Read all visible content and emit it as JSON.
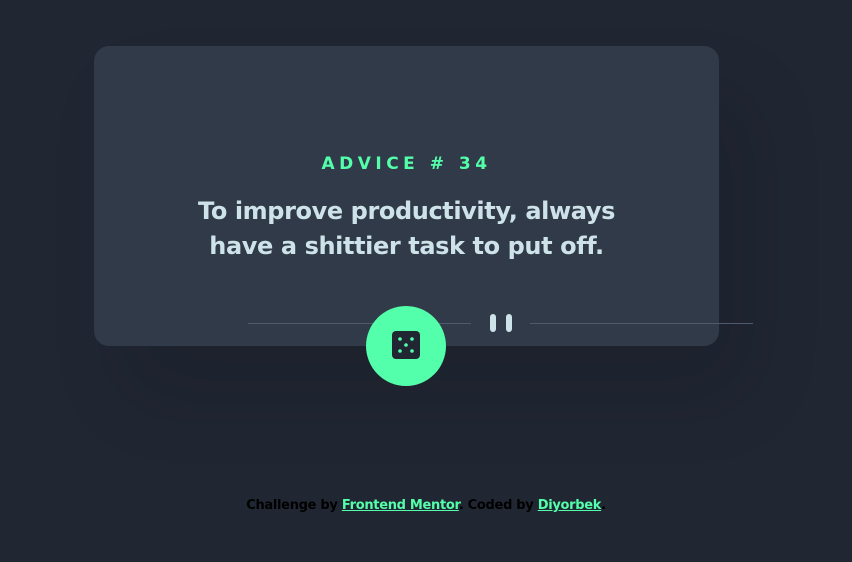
{
  "advice": {
    "label": "ADVICE # 34",
    "text": "To improve productivity, always have a shittier task to put off."
  },
  "attribution": {
    "challenge_prefix": "Challenge by",
    "challenge_link": "Frontend Mentor",
    "coded_prefix": ". Coded by",
    "coded_link": "Diyorbek",
    "suffix": "."
  },
  "colors": {
    "background": "#202632",
    "card": "#313a48",
    "accent": "#53ffaa",
    "text": "#cee3e9",
    "divider": "#4f5b6d"
  },
  "icons": {
    "divider": "pause-divider-icon",
    "button": "dice-icon"
  }
}
